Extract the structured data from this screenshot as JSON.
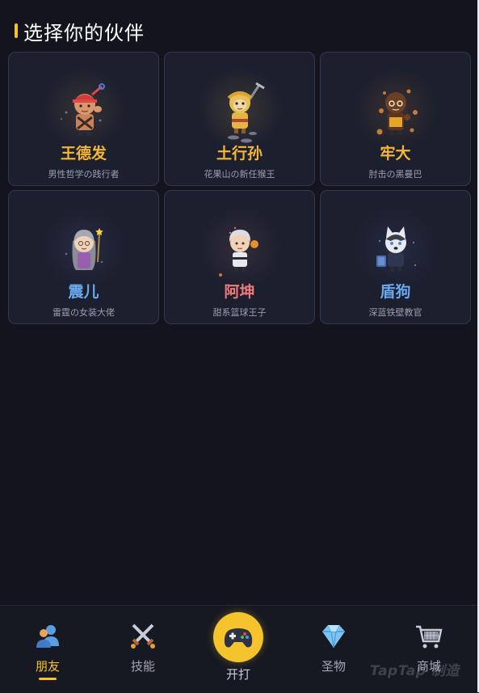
{
  "header": {
    "title": "选择你的伙伴",
    "accent_color": "#f5c32c"
  },
  "partners": [
    {
      "name": "王德发",
      "desc": "男性哲学の践行者",
      "name_color": "#f5b731",
      "avatar": "red-cap-warrior"
    },
    {
      "name": "土行孙",
      "desc": "花果山の新任猴王",
      "name_color": "#f5b731",
      "avatar": "monkey-king"
    },
    {
      "name": "牢大",
      "desc": "肘击の黑曼巴",
      "name_color": "#f5b731",
      "avatar": "dark-fighter"
    },
    {
      "name": "震儿",
      "desc": "雷霆の女装大佬",
      "name_color": "#6aa8f0",
      "avatar": "grey-hair-mage"
    },
    {
      "name": "阿坤",
      "desc": "甜系篮球王子",
      "name_color": "#ef7a7a",
      "avatar": "white-hair-idol"
    },
    {
      "name": "盾狗",
      "desc": "深蓝铁壁教官",
      "name_color": "#6aa8f0",
      "avatar": "husky-guard"
    }
  ],
  "nav": {
    "items": [
      {
        "label": "朋友",
        "icon": "friends-icon",
        "active": true
      },
      {
        "label": "技能",
        "icon": "crossed-swords-icon",
        "active": false
      },
      {
        "label": "开打",
        "icon": "gamepad-icon",
        "active": false
      },
      {
        "label": "圣物",
        "icon": "diamond-icon",
        "active": false
      },
      {
        "label": "商城",
        "icon": "shopping-cart-icon",
        "active": false
      }
    ]
  },
  "watermark": "TapTap 制造"
}
